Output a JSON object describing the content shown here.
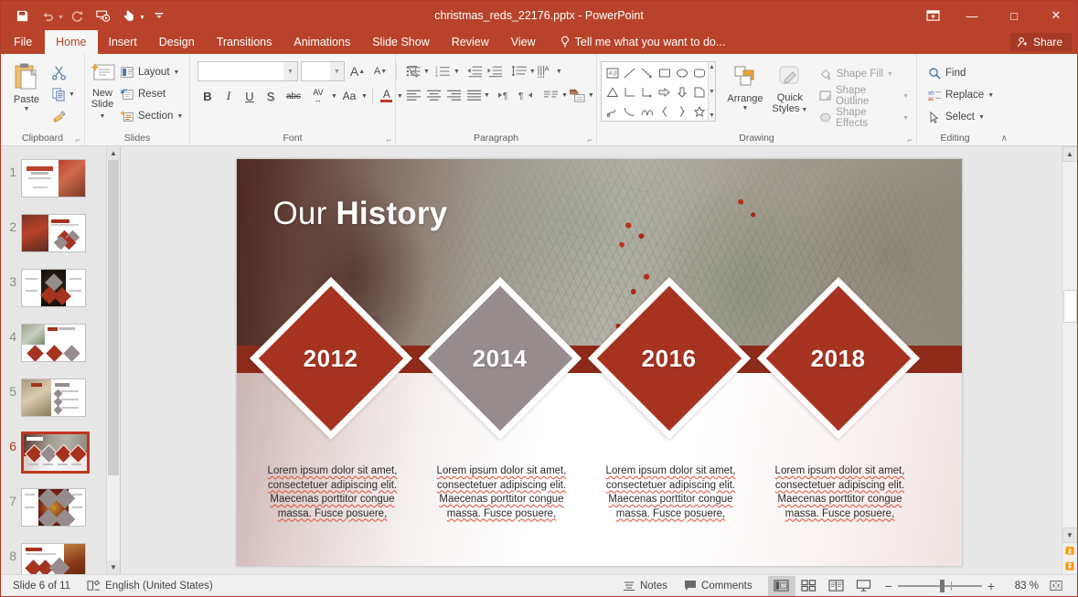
{
  "window": {
    "title": "christmas_reds_22176.pptx - PowerPoint",
    "quick_access": [
      {
        "name": "save-icon",
        "label": "Save"
      },
      {
        "name": "undo-icon",
        "label": "Undo"
      },
      {
        "name": "redo-icon",
        "label": "Repeat"
      },
      {
        "name": "start-from-beginning-icon",
        "label": "Start From Beginning"
      },
      {
        "name": "touch-mode-icon",
        "label": "Touch/Mouse Mode"
      },
      {
        "name": "customize-qat-icon",
        "label": "Customize Quick Access Toolbar"
      }
    ],
    "controls": {
      "ribbon_display": "⤒",
      "minimize": "—",
      "maximize": "□",
      "close": "✕"
    }
  },
  "ribbon": {
    "tabs": [
      {
        "label": "File",
        "active": false
      },
      {
        "label": "Home",
        "active": true
      },
      {
        "label": "Insert",
        "active": false
      },
      {
        "label": "Design",
        "active": false
      },
      {
        "label": "Transitions",
        "active": false
      },
      {
        "label": "Animations",
        "active": false
      },
      {
        "label": "Slide Show",
        "active": false
      },
      {
        "label": "Review",
        "active": false
      },
      {
        "label": "View",
        "active": false
      }
    ],
    "tell_me": "Tell me what you want to do...",
    "share": "Share",
    "collapse_hint": "∧",
    "groups": {
      "clipboard": {
        "label": "Clipboard",
        "paste": "Paste",
        "cut": "Cut",
        "copy": "Copy",
        "format_painter": "Format Painter"
      },
      "slides": {
        "label": "Slides",
        "new_slide_line1": "New",
        "new_slide_line2": "Slide",
        "layout": "Layout",
        "reset": "Reset",
        "section": "Section"
      },
      "font": {
        "label": "Font",
        "font_name_value": "",
        "font_size_value": "",
        "grow_font": "A",
        "shrink_font": "A",
        "clear_formatting": "Clear All Formatting",
        "bold": "B",
        "italic": "I",
        "underline": "U",
        "shadow": "S",
        "strikethrough": "abc",
        "character_spacing": "AV",
        "change_case": "Aa",
        "font_color": "A"
      },
      "paragraph": {
        "label": "Paragraph",
        "bullets": "Bullets",
        "numbering": "Numbering",
        "decrease_indent": "Decrease List Level",
        "increase_indent": "Increase List Level",
        "line_spacing": "Line Spacing",
        "text_direction": "Text Direction",
        "align_text": "Align Text",
        "convert_smartart": "Convert to SmartArt",
        "align_left": "Align Left",
        "center": "Center",
        "align_right": "Align Right",
        "justify": "Justify",
        "ltr": "Left-to-Right",
        "rtl": "Right-to-Left",
        "columns": "Columns"
      },
      "drawing": {
        "label": "Drawing",
        "arrange": "Arrange",
        "quick_styles_line1": "Quick",
        "quick_styles_line2": "Styles",
        "shape_fill": "Shape Fill",
        "shape_outline": "Shape Outline",
        "shape_effects": "Shape Effects"
      },
      "editing": {
        "label": "Editing",
        "find": "Find",
        "replace": "Replace",
        "select": "Select"
      }
    }
  },
  "thumbnails": {
    "selected_index": 6,
    "items": [
      {
        "number": "1"
      },
      {
        "number": "2"
      },
      {
        "number": "3"
      },
      {
        "number": "4"
      },
      {
        "number": "5"
      },
      {
        "number": "6"
      },
      {
        "number": "7"
      },
      {
        "number": "8"
      }
    ]
  },
  "slide": {
    "title_regular": "Our ",
    "title_bold": "History",
    "milestones": [
      {
        "year": "2012",
        "color": "#a63220",
        "caption_line1": "Lorem ipsum dolor sit amet,",
        "caption_line2": "consectetuer adipiscing elit.",
        "caption_line3": "Maecenas porttitor congue",
        "caption_line4": "massa. Fusce posuere,"
      },
      {
        "year": "2014",
        "color": "#978c8d",
        "caption_line1": "Lorem ipsum dolor sit amet,",
        "caption_line2": "consectetuer adipiscing elit.",
        "caption_line3": "Maecenas porttitor congue",
        "caption_line4": "massa. Fusce posuere,"
      },
      {
        "year": "2016",
        "color": "#a63220",
        "caption_line1": "Lorem ipsum dolor sit amet,",
        "caption_line2": "consectetuer adipiscing elit.",
        "caption_line3": "Maecenas porttitor congue",
        "caption_line4": "massa. Fusce posuere,"
      },
      {
        "year": "2018",
        "color": "#a63220",
        "caption_line1": "Lorem ipsum dolor sit amet,",
        "caption_line2": "consectetuer adipiscing elit.",
        "caption_line3": "Maecenas porttitor congue",
        "caption_line4": "massa. Fusce posuere,"
      }
    ]
  },
  "status_bar": {
    "slide_counter": "Slide 6 of 11",
    "language": "English (United States)",
    "notes": "Notes",
    "comments": "Comments",
    "views": [
      {
        "name": "normal-view",
        "glyph": "▤",
        "active": true
      },
      {
        "name": "slide-sorter-view",
        "glyph": "☷",
        "active": false
      },
      {
        "name": "reading-view",
        "glyph": "☷",
        "active": false
      },
      {
        "name": "slide-show-view",
        "glyph": "▭",
        "active": false
      }
    ],
    "zoom_out": "−",
    "zoom_in": "+",
    "zoom_level": "83 %",
    "fit_to_window": "⛶"
  },
  "colors": {
    "brand_red": "#b8432a",
    "accent_dark_red": "#a63220",
    "accent_gray": "#978c8d",
    "band_red": "#8e2a1a",
    "spellcheck": "#e04a3a"
  }
}
